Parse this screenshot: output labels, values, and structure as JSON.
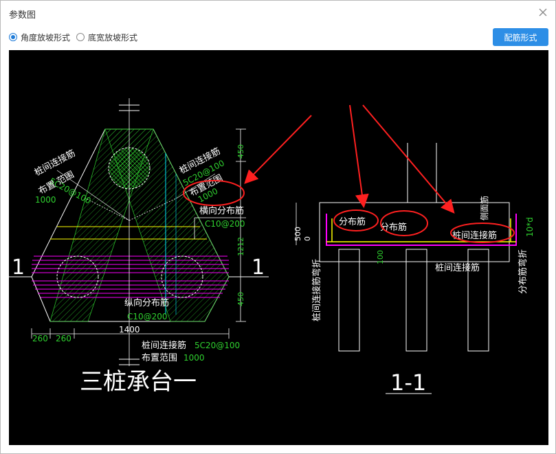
{
  "window": {
    "title": "参数图"
  },
  "options": [
    {
      "label": "角度放坡形式",
      "checked": true
    },
    {
      "label": "底宽放坡形式",
      "checked": false
    }
  ],
  "buttons": {
    "rebar_form": "配筋形式"
  },
  "icons": {
    "close": "close-icon"
  },
  "colors": {
    "canvas_bg": "#000000",
    "green_line": "#2fd12f",
    "white_line": "#ffffff",
    "yellow_line": "#ffff00",
    "magenta_line": "#ff00ff",
    "cyan_line": "#00e5ff",
    "annotation_red": "#ff2020",
    "button_blue": "#2d8ee6"
  },
  "plan": {
    "title": "三桩承台一",
    "section_mark_left": "1",
    "section_mark_right": "1",
    "label_pile_link_upper_left": "桩间连接筋",
    "label_pile_link_upper_left_spec": "5C20@100",
    "label_layout_range_left": "布置 范围",
    "label_layout_range_left_value": "1000",
    "label_pile_link_upper_right": "桩间连接筋",
    "label_pile_link_upper_right_spec": "5C20@100",
    "label_layout_range_right": "布置范围",
    "label_layout_range_right_value": "1000",
    "label_transverse": "横向分布筋",
    "label_transverse_spec": "C10@200",
    "label_longitudinal": "纵向分布筋",
    "label_longitudinal_spec": "C10@200",
    "label_bottom_link": "桩间连接筋",
    "label_bottom_link_spec": "5C20@100",
    "label_bottom_range": "布置范围",
    "label_bottom_range_value": "1000",
    "dim_450_top": "450",
    "dim_1212": "1212",
    "dim_450_bottom": "450",
    "dim_260_a": "260",
    "dim_260_b": "260",
    "dim_1400": "1400"
  },
  "section": {
    "title": "1-1",
    "label_distribution_1": "分布筋",
    "label_distribution_2": "分布筋",
    "label_pile_link": "桩间连接筋",
    "label_pile_link_bottom": "桩间连接筋",
    "label_side_rebar": "侧面筋",
    "label_side_rebar_spec": "ㅤ",
    "label_pile_link_bend": "桩间连接筋弯折",
    "label_distribution_bend": "分布筋弯折",
    "dim_500": "500",
    "dim_0": "0",
    "dim_100": "100",
    "dim_10d": "10*d"
  }
}
